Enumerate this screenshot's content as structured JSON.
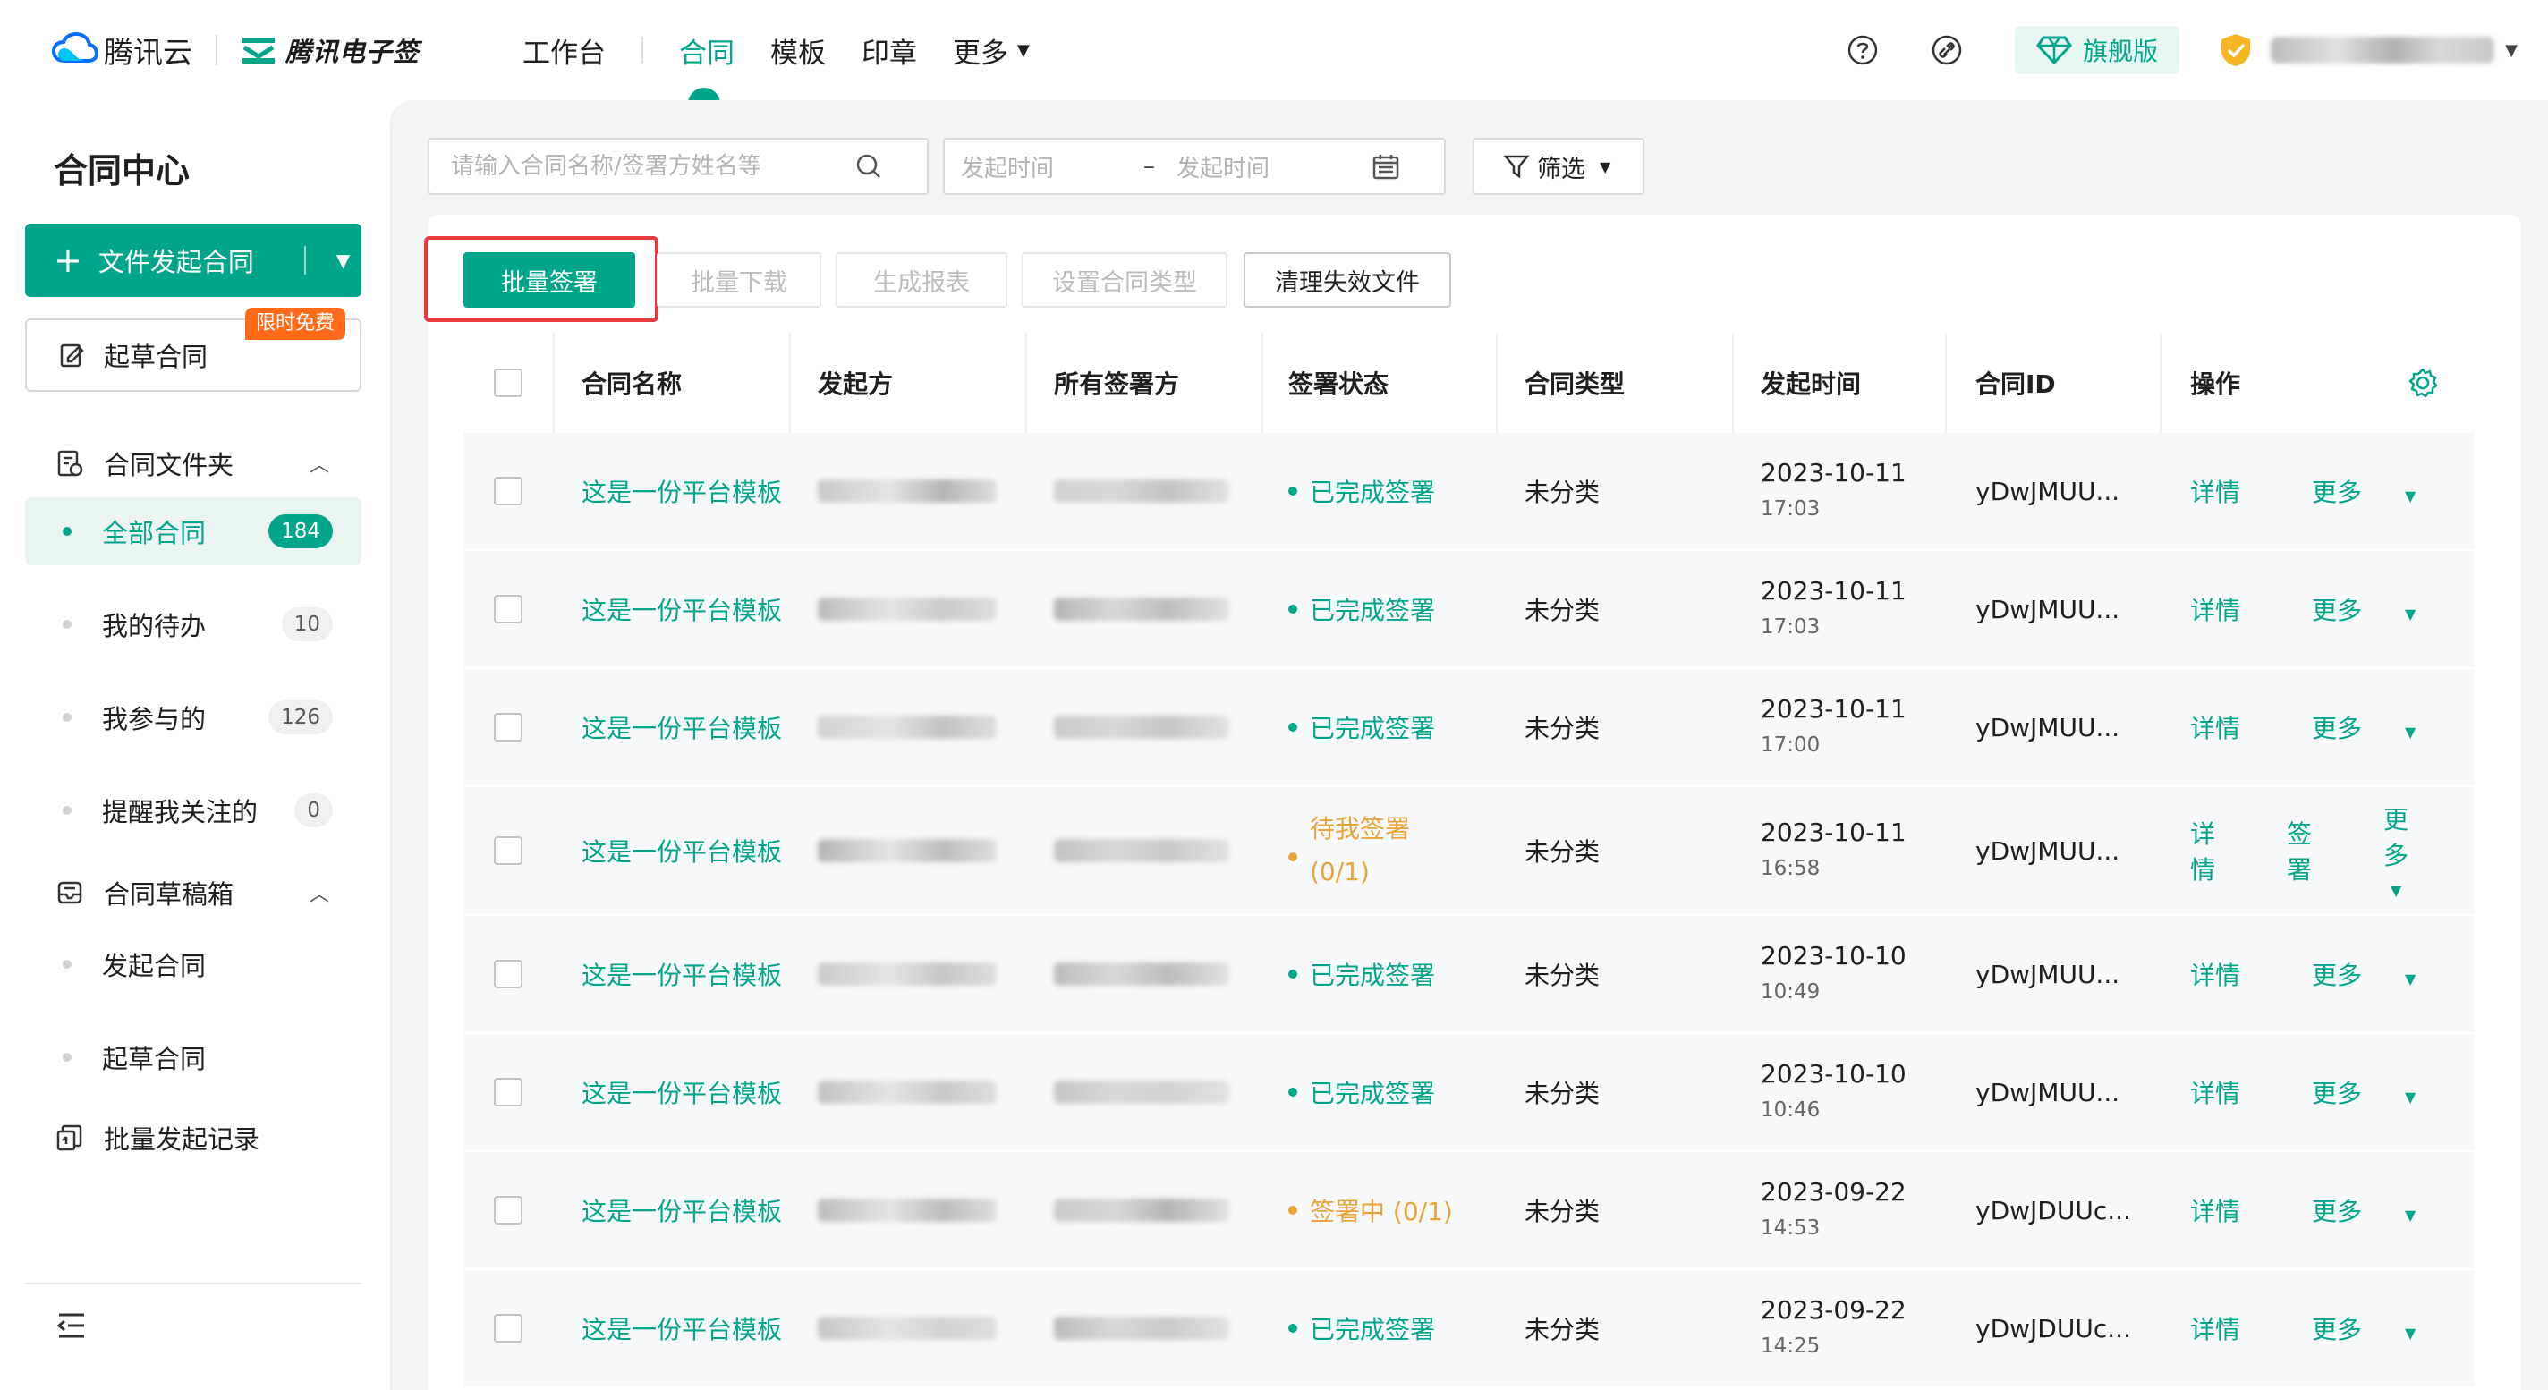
{
  "colors": {
    "accent": "#00a58a",
    "warning": "#e8a33a",
    "highlight": "#e83a3a",
    "free_tag": "#ff6b1a"
  },
  "header": {
    "brand": "腾讯云",
    "product": "腾讯电子签",
    "nav": [
      {
        "label": "工作台"
      },
      {
        "label": "合同",
        "active": true
      },
      {
        "label": "模板"
      },
      {
        "label": "印章"
      },
      {
        "label": "更多"
      }
    ],
    "edition": "旗舰版",
    "icons": [
      "help-icon",
      "link-icon",
      "diamond-icon",
      "shield-icon"
    ]
  },
  "sidebar": {
    "title": "合同中心",
    "start_button": "文件发起合同",
    "draft_button": "起草合同",
    "free_tag": "限时免费",
    "groups": {
      "folder": "合同文件夹",
      "drafts": "合同草稿箱",
      "batch": "批量发起记录"
    },
    "folder_items": [
      {
        "label": "全部合同",
        "count": "184",
        "active": true
      },
      {
        "label": "我的待办",
        "count": "10"
      },
      {
        "label": "我参与的",
        "count": "126"
      },
      {
        "label": "提醒我关注的",
        "count": "0"
      }
    ],
    "draft_items": [
      {
        "label": "发起合同"
      },
      {
        "label": "起草合同"
      }
    ]
  },
  "filters": {
    "search_placeholder": "请输入合同名称/签署方姓名等",
    "date_start": "发起时间",
    "date_sep": "–",
    "date_end": "发起时间",
    "filter_label": "筛选"
  },
  "toolbar": {
    "batch_sign": "批量签署",
    "batch_download": "批量下载",
    "report": "生成报表",
    "set_type": "设置合同类型",
    "clean": "清理失效文件"
  },
  "table": {
    "headers": [
      "合同名称",
      "发起方",
      "所有签署方",
      "签署状态",
      "合同类型",
      "发起时间",
      "合同ID",
      "操作"
    ],
    "rows": [
      {
        "name": "这是一份平台模板",
        "status": "已完成签署",
        "status_kind": "done",
        "type": "未分类",
        "date": "2023-10-11",
        "time": "17:03",
        "id": "yDwJMUU...",
        "ops": [
          "详情",
          "更多"
        ]
      },
      {
        "name": "这是一份平台模板",
        "status": "已完成签署",
        "status_kind": "done",
        "type": "未分类",
        "date": "2023-10-11",
        "time": "17:03",
        "id": "yDwJMUU...",
        "ops": [
          "详情",
          "更多"
        ]
      },
      {
        "name": "这是一份平台模板",
        "status": "已完成签署",
        "status_kind": "done",
        "type": "未分类",
        "date": "2023-10-11",
        "time": "17:00",
        "id": "yDwJMUU...",
        "ops": [
          "详情",
          "更多"
        ]
      },
      {
        "name": "这是一份平台模板",
        "status": "待我签署",
        "status_sub": "(0/1)",
        "status_kind": "pending",
        "type": "未分类",
        "date": "2023-10-11",
        "time": "16:58",
        "id": "yDwJMUU...",
        "ops": [
          "详情",
          "签署",
          "更多"
        ]
      },
      {
        "name": "这是一份平台模板",
        "status": "已完成签署",
        "status_kind": "done",
        "type": "未分类",
        "date": "2023-10-10",
        "time": "10:49",
        "id": "yDwJMUU...",
        "ops": [
          "详情",
          "更多"
        ]
      },
      {
        "name": "这是一份平台模板",
        "status": "已完成签署",
        "status_kind": "done",
        "type": "未分类",
        "date": "2023-10-10",
        "time": "10:46",
        "id": "yDwJMUU...",
        "ops": [
          "详情",
          "更多"
        ]
      },
      {
        "name": "这是一份平台模板",
        "status": "签署中 (0/1)",
        "status_kind": "pending",
        "type": "未分类",
        "date": "2023-09-22",
        "time": "14:53",
        "id": "yDwJDUUc...",
        "ops": [
          "详情",
          "更多"
        ]
      },
      {
        "name": "这是一份平台模板",
        "status": "已完成签署",
        "status_kind": "done",
        "type": "未分类",
        "date": "2023-09-22",
        "time": "14:25",
        "id": "yDwJDUUc...",
        "ops": [
          "详情",
          "更多"
        ]
      }
    ]
  }
}
